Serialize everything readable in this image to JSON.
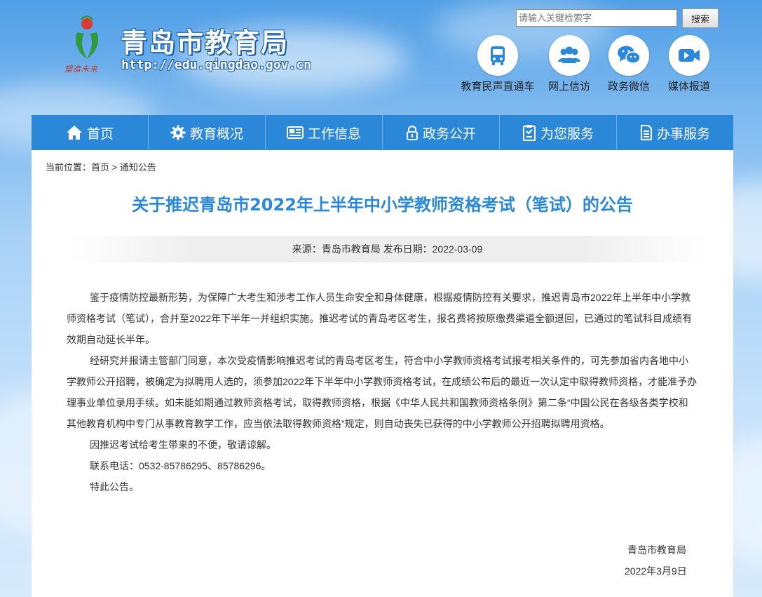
{
  "site": {
    "title": "青岛市教育局",
    "url": "http://edu.qingdao.gov.cn",
    "slogan": "塑造未来"
  },
  "search": {
    "placeholder": "请输入关键检索字",
    "button_label": "搜索"
  },
  "quick_links": [
    {
      "label": "教育民声直通车",
      "icon": "bus-icon"
    },
    {
      "label": "网上信访",
      "icon": "users-icon"
    },
    {
      "label": "政务微信",
      "icon": "wechat-icon"
    },
    {
      "label": "媒体报道",
      "icon": "video-camera-icon"
    }
  ],
  "nav": [
    {
      "label": "首页",
      "icon": "home-icon"
    },
    {
      "label": "教育概况",
      "icon": "gear-icon"
    },
    {
      "label": "工作信息",
      "icon": "newspaper-icon"
    },
    {
      "label": "政务公开",
      "icon": "lock-icon"
    },
    {
      "label": "为您服务",
      "icon": "clipboard-icon"
    },
    {
      "label": "办事服务",
      "icon": "document-icon"
    }
  ],
  "breadcrumb": {
    "prefix": "当前位置：",
    "home": "首页",
    "separator": " > ",
    "current": "通知公告"
  },
  "article": {
    "title": "关于推迟青岛市2022年上半年中小学教师资格考试（笔试）的公告",
    "meta": "来源：青岛市教育局 发布日期：2022-03-09",
    "paragraphs": [
      "鉴于疫情防控最新形势，为保障广大考生和涉考工作人员生命安全和身体健康，根据疫情防控有关要求，推迟青岛市2022年上半年中小学教师资格考试（笔试），合并至2022年下半年一并组织实施。推迟考试的青岛考区考生，报名费将按原缴费渠道全额退回，已通过的笔试科目成绩有效期自动延长半年。",
      "经研究并报请主管部门同意，本次受疫情影响推迟考试的青岛考区考生，符合中小学教师资格考试报考相关条件的，可先参加省内各地中小学教师公开招聘，被确定为拟聘用人选的，须参加2022年下半年中小学教师资格考试，在成绩公布后的最近一次认定中取得教师资格，才能准予办理事业单位录用手续。如未能如期通过教师资格考试，取得教师资格，根据《中华人民共和国教师资格条例》第二条“中国公民在各级各类学校和其他教育机构中专门从事教育教学工作，应当依法取得教师资格”规定，则自动丧失已获得的中小学教师公开招聘拟聘用资格。",
      "因推迟考试给考生带来的不便，敬请谅解。",
      "联系电话：0532-85786295、85786296。",
      "特此公告。"
    ],
    "signature_org": "青岛市教育局",
    "signature_date": "2022年3月9日"
  },
  "colors": {
    "primary": "#2b87d8",
    "title": "#2b87d8",
    "logo_red": "#d93a2b",
    "logo_green": "#2e9a3c"
  }
}
